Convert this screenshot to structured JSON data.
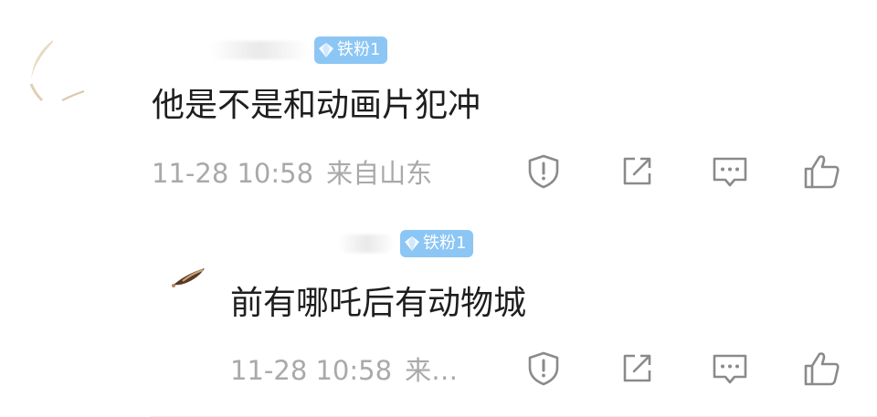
{
  "comments": [
    {
      "badge": "铁粉1",
      "text": "他是不是和动画片犯冲",
      "time": "11-28 10:58",
      "location": "来自山东",
      "actions": {
        "report": "shield-alert-icon",
        "share": "share-icon",
        "reply": "comment-icon",
        "like": "thumbs-up-icon"
      }
    },
    {
      "badge": "铁粉1",
      "text": "前有哪吒后有动物城",
      "time": "11-28 10:58",
      "location": "来…",
      "actions": {
        "report": "shield-alert-icon",
        "share": "share-icon",
        "reply": "comment-icon",
        "like": "thumbs-up-icon"
      }
    }
  ],
  "colors": {
    "badge_bg": "#8cc6f5",
    "meta_text": "#a9a9a9",
    "icon_stroke": "#8a8a8a",
    "content_text": "#1e1e1e"
  }
}
